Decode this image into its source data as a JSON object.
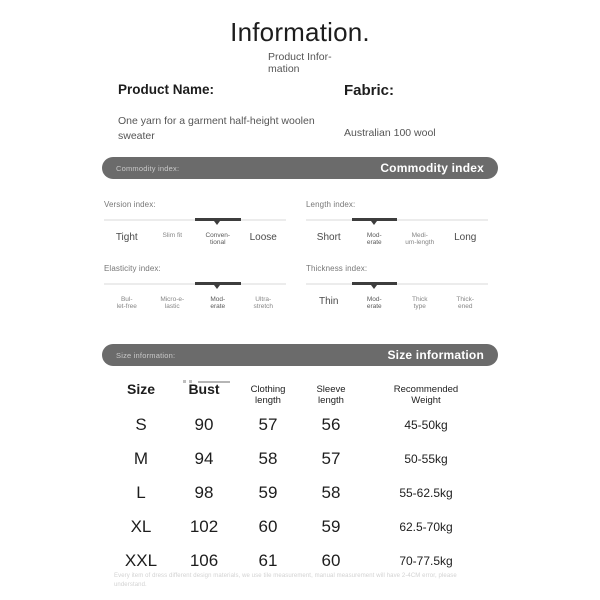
{
  "header": {
    "title": "Information.",
    "subtitle": "Product Infor-\nmation"
  },
  "product": {
    "name_label": "Product Name:",
    "name_value": "One yarn for a garment half-height woolen sweater",
    "fabric_label": "Fabric:",
    "fabric_value": "Australian 100 wool"
  },
  "commodity_bar": {
    "left_label": "Commodity index:",
    "right_label": "Commodity index"
  },
  "size_bar": {
    "left_label": "Size information:",
    "right_label": "Size information"
  },
  "indices": [
    {
      "title": "Version index:",
      "selected": 2,
      "options": [
        "Tight",
        "Slim fit",
        "Conven-\ntional",
        "Loose"
      ]
    },
    {
      "title": "Length index:",
      "selected": 1,
      "options": [
        "Short",
        "Mod-\nerate",
        "Medi-\num-length",
        "Long"
      ]
    },
    {
      "title": "Elasticity index:",
      "selected": 2,
      "options": [
        "Bul-\nlet-free",
        "Micro-e-\nlastic",
        "Mod-\nerate",
        "Ultra-\nstretch"
      ]
    },
    {
      "title": "Thickness index:",
      "selected": 1,
      "options": [
        "Thin",
        "Mod-\nerate",
        "Thick\ntype",
        "Thick-\nened"
      ]
    }
  ],
  "size_table": {
    "columns": [
      "Size",
      "Bust",
      "Clothing\nlength",
      "Sleeve\nlength",
      "Recommended\nWeight"
    ],
    "rows": [
      {
        "size": "S",
        "bust": "90",
        "clothing": "57",
        "sleeve": "56",
        "weight": "45-50kg"
      },
      {
        "size": "M",
        "bust": "94",
        "clothing": "58",
        "sleeve": "57",
        "weight": "50-55kg"
      },
      {
        "size": "L",
        "bust": "98",
        "clothing": "59",
        "sleeve": "58",
        "weight": "55-62.5kg"
      },
      {
        "size": "XL",
        "bust": "102",
        "clothing": "60",
        "sleeve": "59",
        "weight": "62.5-70kg"
      },
      {
        "size": "XXL",
        "bust": "106",
        "clothing": "61",
        "sleeve": "60",
        "weight": "70-77.5kg"
      }
    ]
  },
  "footer": {
    "note": "Every item of dress different design materials, we use tile measurement, manual measurement will have 2-4CM error, please understand."
  },
  "colors": {
    "bar_background": "#6b6b6b",
    "slider_track": "#ececec",
    "slider_fill": "#3d3d3d",
    "page_background": "#ffffff"
  }
}
